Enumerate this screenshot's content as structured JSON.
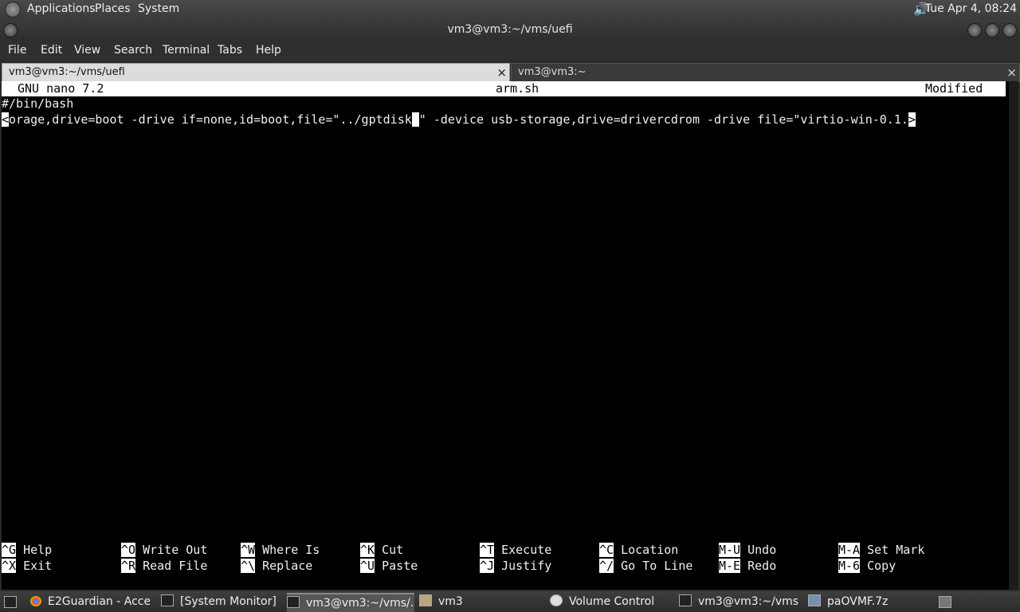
{
  "top_panel": {
    "menus": [
      "Applications",
      "Places",
      "System"
    ],
    "clock": "Tue Apr  4, 08:24"
  },
  "window": {
    "title": "vm3@vm3:~/vms/uefi",
    "menubar": [
      "File",
      "Edit",
      "View",
      "Search",
      "Terminal",
      "Tabs",
      "Help"
    ],
    "tabs": [
      {
        "label": "vm3@vm3:~/vms/uefi",
        "close": "×"
      },
      {
        "label": "vm3@vm3:~",
        "close": "×"
      }
    ]
  },
  "nano": {
    "version": "GNU nano 7.2",
    "filename": "arm.sh",
    "status": "Modified",
    "lines": [
      "#/bin/bash",
      "orage,drive=boot -drive if=none,id=boot,file=\"../gptdisk",
      "\" -device usb-storage,drive=drivercdrom -drive file=\"virtio-win-0.1."
    ],
    "left_marker": "<",
    "right_marker": ">",
    "shortcuts": [
      {
        "key": "^G",
        "label": "Help"
      },
      {
        "key": "^O",
        "label": "Write Out"
      },
      {
        "key": "^W",
        "label": "Where Is"
      },
      {
        "key": "^K",
        "label": "Cut"
      },
      {
        "key": "^T",
        "label": "Execute"
      },
      {
        "key": "^C",
        "label": "Location"
      },
      {
        "key": "M-U",
        "label": "Undo"
      },
      {
        "key": "M-A",
        "label": "Set Mark"
      },
      {
        "key": "^X",
        "label": "Exit"
      },
      {
        "key": "^R",
        "label": "Read File"
      },
      {
        "key": "^\\",
        "label": "Replace"
      },
      {
        "key": "^U",
        "label": "Paste"
      },
      {
        "key": "^J",
        "label": "Justify"
      },
      {
        "key": "^/",
        "label": "Go To Line"
      },
      {
        "key": "M-E",
        "label": "Redo"
      },
      {
        "key": "M-6",
        "label": "Copy"
      }
    ]
  },
  "taskbar": {
    "items": [
      {
        "label": "E2Guardian - Acce...",
        "icon": "chrome-icon"
      },
      {
        "label": "[System Monitor]",
        "icon": "system-monitor-icon"
      },
      {
        "label": "vm3@vm3:~/vms/...",
        "icon": "terminal-icon"
      },
      {
        "label": "vm3",
        "icon": "folder-icon"
      },
      {
        "label": "Volume Control",
        "icon": "volume-icon"
      },
      {
        "label": "vm3@vm3:~/vms",
        "icon": "terminal-icon"
      },
      {
        "label": "paOVMF.7z",
        "icon": "archive-icon"
      }
    ]
  }
}
